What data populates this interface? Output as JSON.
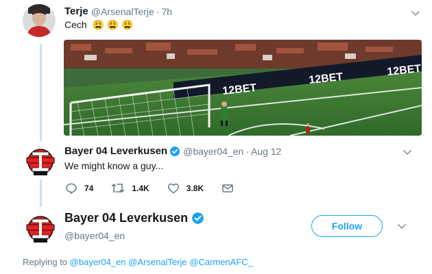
{
  "tweet1": {
    "name": "Terje",
    "handle": "@ArsenalTerje",
    "separator": "·",
    "time": "7h",
    "text": "Cech",
    "emoji": [
      "😩",
      "😩",
      "😩"
    ],
    "media_sponsor": "12BET"
  },
  "tweet2": {
    "name": "Bayer 04 Leverkusen",
    "handle": "@bayer04_en",
    "separator": "·",
    "time": "Aug 12",
    "text": "We might know a guy...",
    "actions": {
      "replies": "74",
      "retweets": "1.4K",
      "likes": "3.8K"
    }
  },
  "reply_author": {
    "name": "Bayer 04 Leverkusen",
    "handle": "@bayer04_en",
    "follow_label": "Follow"
  },
  "replying": {
    "prefix": "Replying to",
    "mentions": [
      "@bayer04_en",
      "@ArsenalTerje",
      "@CarmenAFC_"
    ]
  },
  "colors": {
    "accent": "#1da1f2",
    "thread": "#c4e4f4",
    "muted": "#657786",
    "bayer_red": "#e32221"
  }
}
